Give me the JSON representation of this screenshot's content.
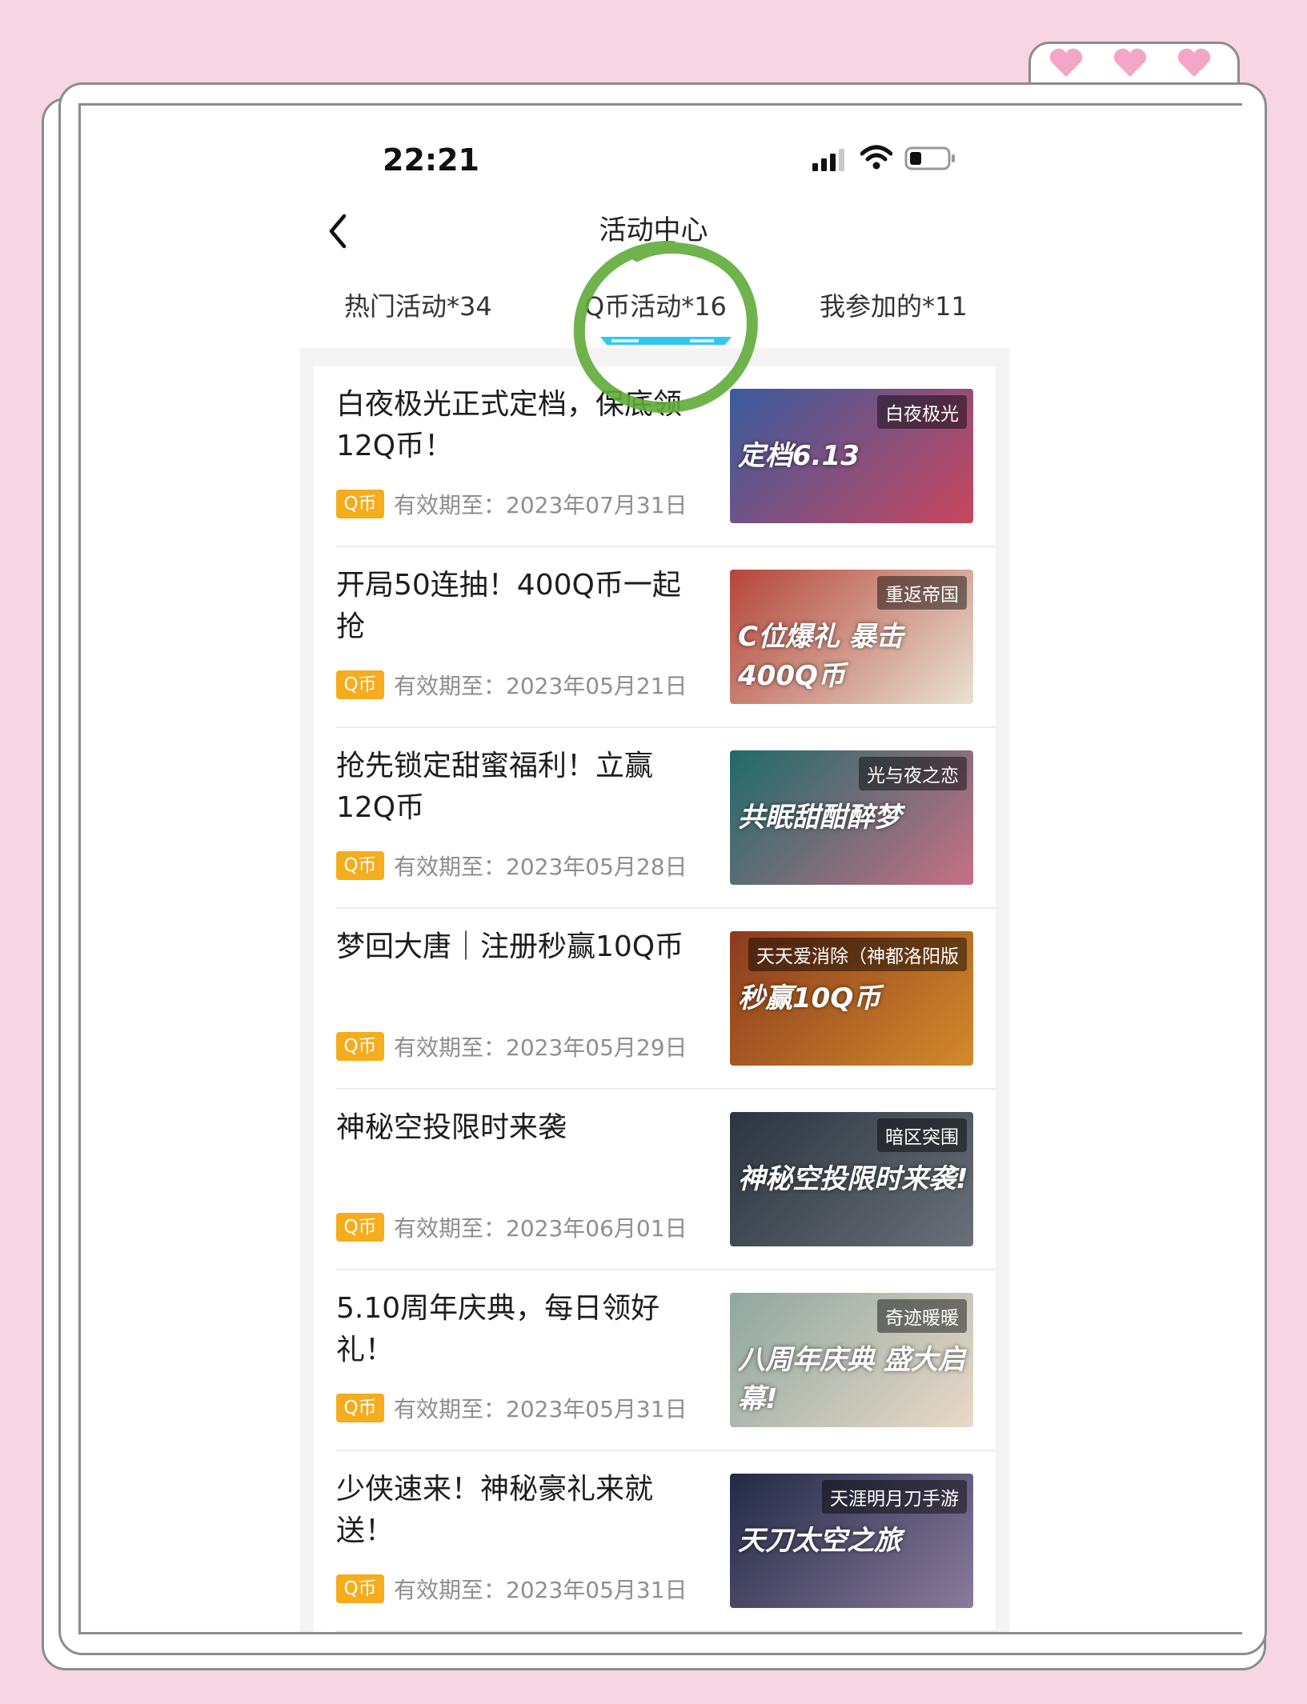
{
  "status_bar": {
    "time": "22:21"
  },
  "nav": {
    "title": "活动中心"
  },
  "tabs": [
    {
      "label": "热门活动*34",
      "selected": false
    },
    {
      "label": "Q币活动*16",
      "selected": true
    },
    {
      "label": "我参加的*11",
      "selected": false
    }
  ],
  "activities": [
    {
      "title": "白夜极光正式定档，保底领12Q币！",
      "badge": "Q币",
      "validity": "有效期至：2023年07月31日",
      "thumb_tag": "白夜极光",
      "thumb_art": "定档6.13",
      "colors": [
        "#3a5b9e",
        "#c9465e"
      ]
    },
    {
      "title": "开局50连抽！400Q币一起抢",
      "badge": "Q币",
      "validity": "有效期至：2023年05月21日",
      "thumb_tag": "重返帝国",
      "thumb_art": "C位爆礼 暴击400Q币",
      "colors": [
        "#b5453a",
        "#e9e2d2"
      ]
    },
    {
      "title": "抢先锁定甜蜜福利！立赢12Q币",
      "badge": "Q币",
      "validity": "有效期至：2023年05月28日",
      "thumb_tag": "光与夜之恋",
      "thumb_art": "共眠甜酣醉梦",
      "colors": [
        "#1f6b6a",
        "#c67085"
      ]
    },
    {
      "title": "梦回大唐｜注册秒赢10Q币",
      "badge": "Q币",
      "validity": "有效期至：2023年05月29日",
      "thumb_tag": "天天爱消除（神都洛阳版",
      "thumb_art": "秒赢10Q币",
      "colors": [
        "#8a3b1e",
        "#d48a2a"
      ]
    },
    {
      "title": "神秘空投限时来袭",
      "badge": "Q币",
      "validity": "有效期至：2023年06月01日",
      "thumb_tag": "暗区突围",
      "thumb_art": "神秘空投限时来袭!",
      "colors": [
        "#2b3440",
        "#6a7078"
      ]
    },
    {
      "title": "5.10周年庆典，每日领好礼！",
      "badge": "Q币",
      "validity": "有效期至：2023年05月31日",
      "thumb_tag": "奇迹暖暖",
      "thumb_art": "八周年庆典 盛大启幕!",
      "colors": [
        "#8fa7a0",
        "#e9d9c8"
      ]
    },
    {
      "title": "少侠速来！神秘豪礼来就送！",
      "badge": "Q币",
      "validity": "有效期至：2023年05月31日",
      "thumb_tag": "天涯明月刀手游",
      "thumb_art": "天刀太空之旅",
      "colors": [
        "#222a45",
        "#8a7a9c"
      ]
    }
  ],
  "decoration": {
    "heart_color": "#f4a6c8",
    "annotation_color": "#5fab3a",
    "indicator_color": "#35c6f0"
  }
}
